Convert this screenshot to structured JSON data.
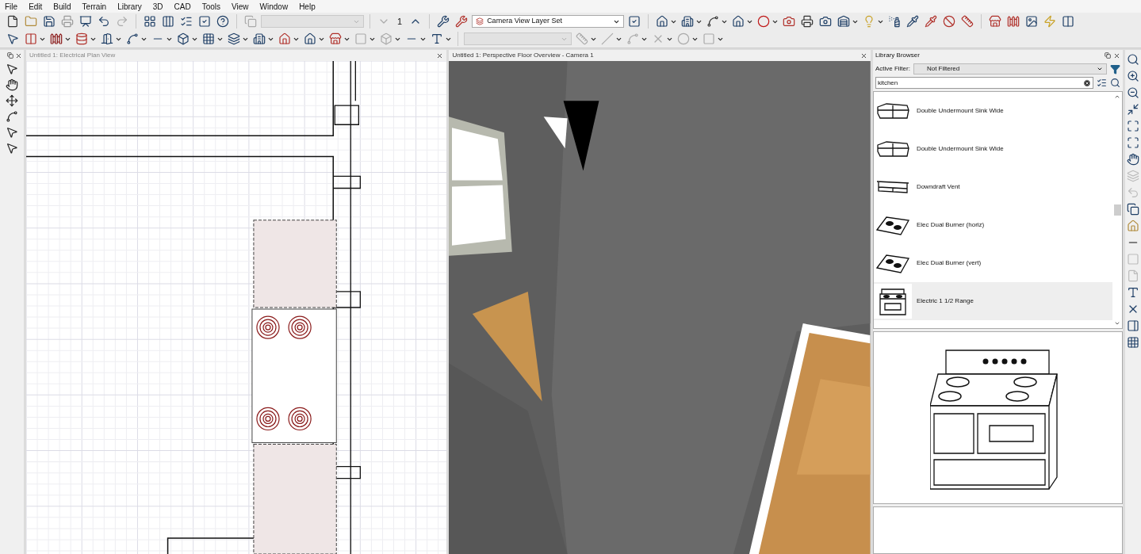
{
  "menu": [
    "File",
    "Edit",
    "Build",
    "Terrain",
    "Library",
    "3D",
    "CAD",
    "Tools",
    "View",
    "Window",
    "Help"
  ],
  "toolbar": {
    "floor": "1",
    "layer_set": "Camera View Layer Set"
  },
  "plan_view": {
    "title": "Untitled 1: Electrical Plan View"
  },
  "camera_view": {
    "title": "Untitled 1: Perspective Floor Overview - Camera 1"
  },
  "library": {
    "title": "Library Browser",
    "filter_label": "Active Filter:",
    "filter": "Not Filtered",
    "search": "kitchen",
    "items": [
      {
        "name": "Double Undermount Sink Wide",
        "kind": "sink",
        "selected": false
      },
      {
        "name": "Double Undermount Sink Wide",
        "kind": "sink",
        "selected": false
      },
      {
        "name": "Downdraft Vent",
        "kind": "vent",
        "selected": false
      },
      {
        "name": "Elec Dual Burner (horiz)",
        "kind": "cooktop",
        "selected": false
      },
      {
        "name": "Elec Dual Burner (vert)",
        "kind": "cooktop",
        "selected": false
      },
      {
        "name": "Electric 1 1/2 Range",
        "kind": "range",
        "selected": true
      }
    ]
  }
}
